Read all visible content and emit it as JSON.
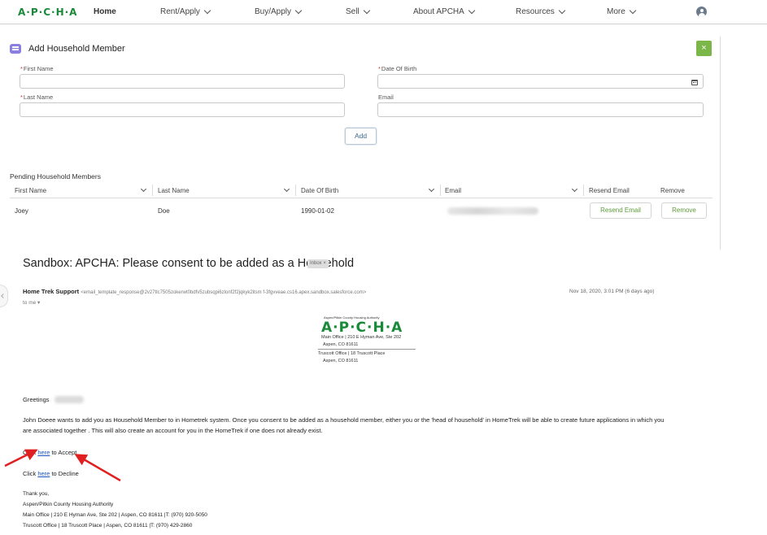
{
  "nav": {
    "logo": "A·P·C·H·A",
    "items": [
      {
        "label": "Home",
        "has_menu": false
      },
      {
        "label": "Rent/Apply",
        "has_menu": true
      },
      {
        "label": "Buy/Apply",
        "has_menu": true
      },
      {
        "label": "Sell",
        "has_menu": true
      },
      {
        "label": "About APCHA",
        "has_menu": true
      },
      {
        "label": "Resources",
        "has_menu": true
      },
      {
        "label": "More",
        "has_menu": true
      }
    ],
    "user_icon": "user-avatar-icon"
  },
  "form": {
    "title": "Add Household Member",
    "close_label": "×",
    "required_mark": "*",
    "first_name": {
      "label": "First Name",
      "value": ""
    },
    "last_name": {
      "label": "Last Name",
      "value": ""
    },
    "dob": {
      "label": "Date Of Birth",
      "value": ""
    },
    "email": {
      "label": "Email",
      "value": ""
    },
    "add_label": "Add"
  },
  "pending": {
    "title": "Pending Household Members",
    "columns": [
      "First Name",
      "Last Name",
      "Date Of Birth",
      "Email",
      "Resend Email",
      "Remove"
    ],
    "rows": [
      {
        "first_name": "Joey",
        "last_name": "Doe",
        "dob": "1990-01-02",
        "resend_label": "Resend Email",
        "remove_label": "Remove"
      }
    ]
  },
  "email": {
    "subject": "Sandbox: APCHA: Please consent to be added as a Household",
    "inbox_tag": "Inbox ×",
    "sender_name": "Home Trek Support",
    "sender_address": "<email_template_response@2v27tlc7505zokerwt0bdfv5zubsqpi6zlonf2f2jqkyk2itsm f-3fgvveae.cs16.apex.sandbox.salesforce.com>",
    "to": "to me ▾",
    "date": "Nov 18, 2020, 3:01 PM (6 days ago)",
    "logo_small": "Aspen/Pitkin County Housing Authority",
    "logo": "A·P·C·H·A",
    "logo_lines": [
      "Main Office | 210 E Hyman Ave, Ste 202",
      "Aspen, CO 81611",
      "Truscott Office | 18 Truscott Place",
      "Aspen, CO 81611"
    ],
    "greeting": "Greetings",
    "paragraph": "John Doeee wants to add you as Household Member to in Hometrek system. Once you consent to be added as a household member, either you or the 'head of household' in HomeTrek will be able to create future applications in which you are associated together . This will also create an account for you in the HomeTrek if one does not already exist.",
    "accept": {
      "prefix": "Click ",
      "link": "here",
      "suffix": " to Accept"
    },
    "decline": {
      "prefix": "Click ",
      "link": "here",
      "suffix": " to Decline"
    },
    "signature": [
      "Thank you,",
      "Aspen/Pitkin County Housing Authority",
      "Main Office | 210 E Hyman Ave, Ste 202 | Aspen, CO 81611 |T: (970) 920-5050",
      "Truscott Office | 18 Truscott Place | Aspen, CO 81611 |T: (970) 429-2860"
    ]
  },
  "colors": {
    "brand_green": "#1a8a3a",
    "close_green": "#7ab648",
    "arrow_red": "#e02020",
    "link_blue": "#1a55c8"
  }
}
